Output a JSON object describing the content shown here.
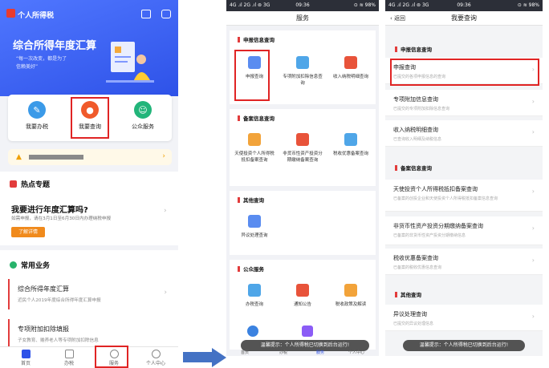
{
  "colors": {
    "brand": "#2e52e8",
    "highlight": "#e02424",
    "arrow": "#4472c4"
  },
  "p1": {
    "app_title": "个人所得税",
    "banner_title": "综合所得年度汇算",
    "banner_line1": "“每一次改变，都是为了",
    "banner_line2": "信赖美好”",
    "quick": [
      {
        "label": "我要办税",
        "icon": "pen-icon"
      },
      {
        "label": "我要查询",
        "icon": "search-icon"
      },
      {
        "label": "公众服务",
        "icon": "service-icon"
      }
    ],
    "hot_title": "热点专题",
    "hot_question": "我要进行年度汇算吗?",
    "hot_sub": "如需申报，请在3月1日至6月30日内办理纳税申报",
    "hot_button": "了解详情",
    "common_title": "常用业务",
    "biz": [
      {
        "title": "综合所得年度汇算",
        "sub": "近民个人2019年度综合所得年度汇算申报"
      },
      {
        "title": "专项附加扣除填报",
        "sub": "子女教育、赡养老人等专项附加扣除信息"
      }
    ],
    "tabs": [
      "首页",
      "办税",
      "服务",
      "个人中心"
    ]
  },
  "p2": {
    "status_left": "4G .ıl 2G .ıl ⊚ 3G",
    "time": "09:36",
    "status_right": "⊙ ≋ 98%",
    "nav_title": "服务",
    "sections": [
      {
        "title": "申报信息查询",
        "items": [
          "申报查询",
          "专项附加扣除信息查询",
          "收入纳税明细查询"
        ]
      },
      {
        "title": "备案信息查询",
        "items": [
          "天使投资个人所得税抵扣备案查询",
          "非货币性资产投资分期缴纳备案查询",
          "税收优惠备案查询"
        ]
      },
      {
        "title": "其他查询",
        "items": [
          "异议处理查询"
        ]
      },
      {
        "title": "公众服务",
        "items": [
          "办税查询",
          "通知公告",
          "税收政策及解读"
        ]
      }
    ],
    "toast": "温馨提示：个人所得税已切换到后台运行!",
    "tabs": [
      "首页",
      "办税",
      "服务",
      "个人中心"
    ]
  },
  "p3": {
    "status_left": "4G .ıl 2G .ıl ⊚ 3G",
    "time": "09:36",
    "status_right": "⊙ ≋ 98%",
    "back": "返回",
    "nav_title": "我要查询",
    "sec1": "申报信息查询",
    "rows1": [
      {
        "t": "申报查询",
        "s": "已提交的各项申报信息的查询"
      },
      {
        "t": "专项附加信息查询",
        "s": "已提交的专项附加扣除信息查询"
      },
      {
        "t": "收入纳税明细查询",
        "s": "已查询收入明细及纳税信息"
      }
    ],
    "sec2": "备案信息查询",
    "rows2": [
      {
        "t": "天使投资个人所得税抵扣备案查询",
        "s": "已备案的创投企业和天使投资个人所得税抵扣备案信息查询"
      },
      {
        "t": "非货币性资产投资分期缴纳备案查询",
        "s": "已备案的非货币性资产投资分期缴纳信息"
      },
      {
        "t": "税收优惠备案查询",
        "s": "已备案的税收优惠信息查询"
      }
    ],
    "sec3": "其他查询",
    "rows3": [
      {
        "t": "异议处理查询",
        "s": "已提交的异议处理信息"
      }
    ],
    "toast": "温馨提示：个人所得税已切换到后台运行!"
  }
}
